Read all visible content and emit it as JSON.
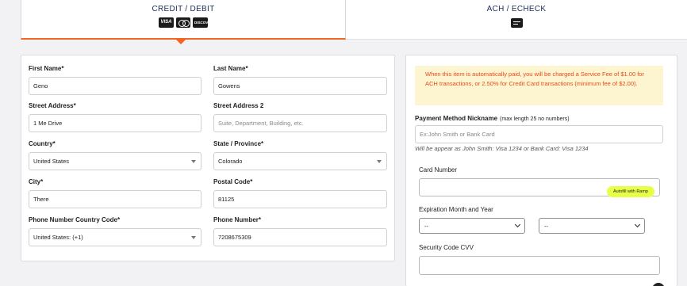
{
  "tabs": {
    "credit": {
      "label": "CREDIT / DEBIT",
      "card_icons": [
        "visa-icon",
        "mastercard-icon",
        "discover-icon"
      ],
      "visa_text": "VISA",
      "discover_text": "DISCOVER"
    },
    "ach": {
      "label": "ACH / ECHECK",
      "icon": "check-icon"
    }
  },
  "address_form": {
    "first_name": {
      "label": "First Name*",
      "value": "Geno"
    },
    "last_name": {
      "label": "Last Name*",
      "value": "Gowens"
    },
    "street_address": {
      "label": "Street Address*",
      "value": "1 Me Drive"
    },
    "street_address_2": {
      "label": "Street Address 2",
      "placeholder": "Suite, Department, Building, etc."
    },
    "country": {
      "label": "Country*",
      "value": "United States"
    },
    "state": {
      "label": "State / Province*",
      "value": "Colorado"
    },
    "city": {
      "label": "City*",
      "value": "There"
    },
    "postal_code": {
      "label": "Postal Code*",
      "value": "81125"
    },
    "phone_country_code": {
      "label": "Phone Number Country Code*",
      "value": "United States: (+1)"
    },
    "phone_number": {
      "label": "Phone Number*",
      "value": "7208675309"
    }
  },
  "payment": {
    "notice": "When this item is automatically paid, you will be charged a Service Fee of $1.00 for ACH transactions, or 2.50% for Credit Card transactions (minimum fee of $2.00).",
    "nickname_label": "Payment Method Nickname",
    "nickname_hint": "(max length 25 no numbers)",
    "nickname_placeholder": "Ex:John Smith or Bank Card",
    "nickname_help": "Will be appear as John Smith: Visa 1234 or Bank Card: Visa 1234",
    "card_number_label": "Card Number",
    "autofill_label": "Autofill with Ramp",
    "expiration_label": "Expiration Month and Year",
    "month_value": "--",
    "year_value": "--",
    "cvv_label": "Security Code CVV"
  },
  "colors": {
    "accent": "#f26522",
    "notice_bg": "#fdf5cf",
    "notice_text": "#e84a20",
    "autofill_bg": "#e8ff48"
  }
}
